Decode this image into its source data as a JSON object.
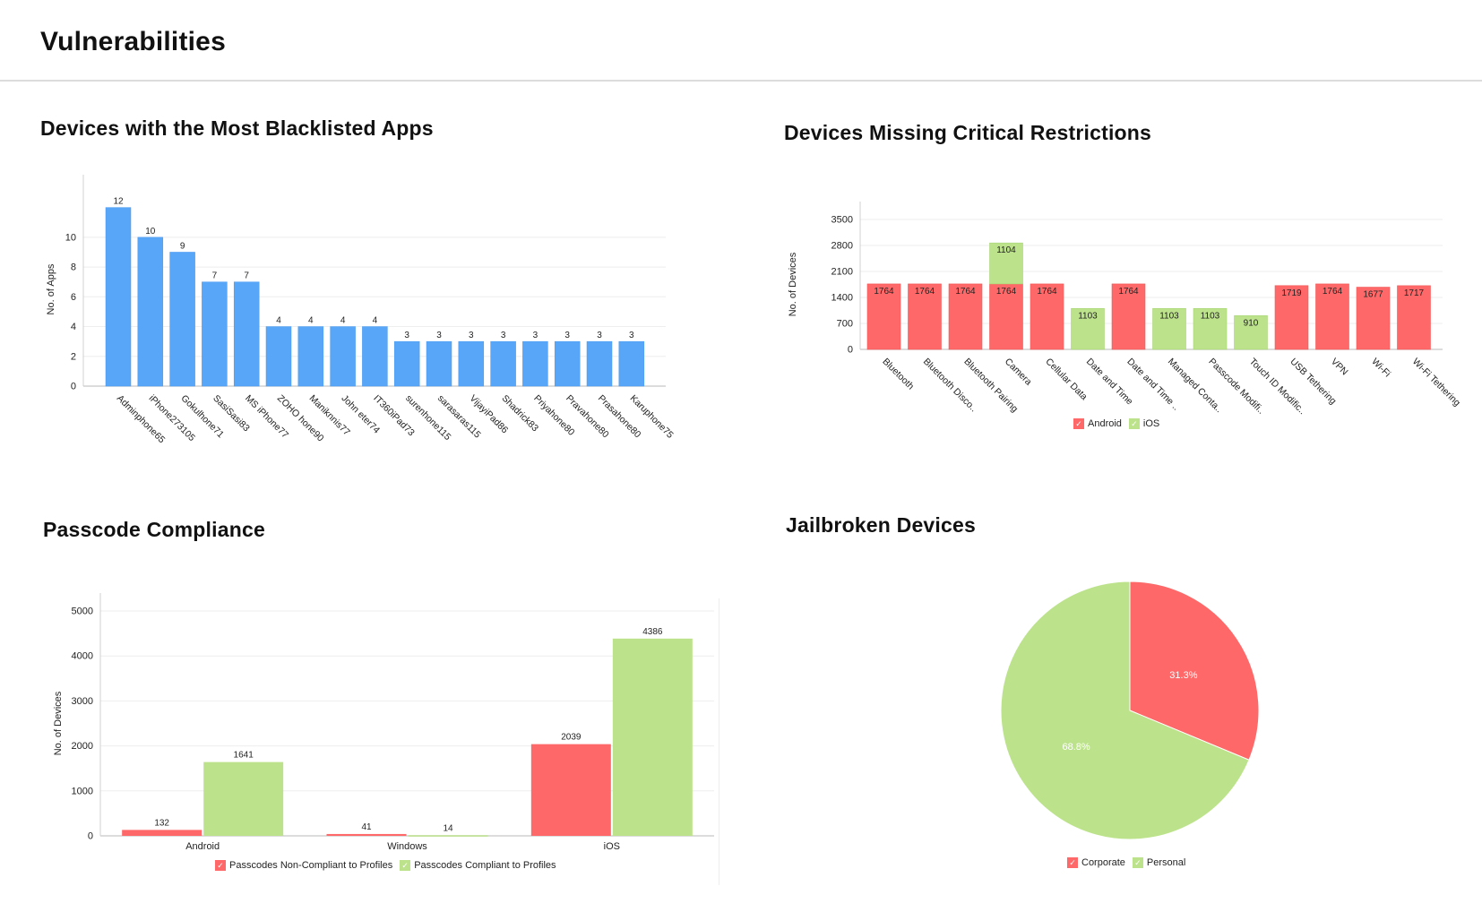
{
  "page": {
    "title": "Vulnerabilities"
  },
  "colors": {
    "blue": "#57a6f8",
    "red": "#ff6868",
    "green": "#bce38b",
    "grid": "#eeeeee",
    "axis": "#d0d0d0"
  },
  "chart_data": [
    {
      "id": "blacklisted",
      "type": "bar",
      "title": "Devices with the Most Blacklisted Apps",
      "xlabel": "",
      "ylabel": "No. of Apps",
      "ylim": [
        0,
        13
      ],
      "yticks": [
        0,
        2,
        4,
        6,
        8,
        10
      ],
      "grid": true,
      "categories": [
        "Adminphone65",
        "iPhone273105",
        "Gokulhone71",
        "SasiSasi83",
        "MS iPhone77",
        "ZOHO hone90",
        "Maniknnis77",
        "John eter74",
        "IT360iPad73",
        "surenhone115",
        "sarasaras115",
        "VijayiPad86",
        "Shadrick83",
        "Priyahone80",
        "Pravahone80",
        "Prasahone80",
        "Karuphone75"
      ],
      "values": [
        12,
        10,
        9,
        7,
        7,
        4,
        4,
        4,
        4,
        3,
        3,
        3,
        3,
        3,
        3,
        3,
        3
      ]
    },
    {
      "id": "restrictions",
      "type": "bar",
      "stacked": true,
      "title": "Devices Missing Critical Restrictions",
      "xlabel": "",
      "ylabel": "No. of Devices",
      "ylim": [
        0,
        3500
      ],
      "yticks": [
        0,
        700,
        1400,
        2100,
        2800,
        3500
      ],
      "grid": true,
      "legend_position": "bottom",
      "categories": [
        "Bluetooth",
        "Bluetooth Disco..",
        "Bluetooth Pairing",
        "Camera",
        "Cellular Data",
        "Date and Time",
        "Date and Time ..",
        "Managed Conta..",
        "Passcode Modifi..",
        "Touch ID Modific..",
        "USB Tethering",
        "VPN",
        "Wi-Fi",
        "Wi-Fi Tethering"
      ],
      "series": [
        {
          "name": "Android",
          "color": "#ff6868",
          "values": [
            1764,
            1764,
            1764,
            1764,
            1764,
            0,
            1764,
            0,
            0,
            0,
            1719,
            1764,
            1677,
            1717
          ]
        },
        {
          "name": "iOS",
          "color": "#bce38b",
          "values": [
            0,
            0,
            0,
            1104,
            0,
            1103,
            0,
            1103,
            1103,
            910,
            0,
            0,
            0,
            0
          ]
        }
      ]
    },
    {
      "id": "passcode",
      "type": "bar",
      "grouped": true,
      "title": "Passcode Compliance",
      "xlabel": "",
      "ylabel": "No. of Devices",
      "ylim": [
        0,
        5000
      ],
      "yticks": [
        0,
        1000,
        2000,
        3000,
        4000,
        5000
      ],
      "grid": true,
      "legend_position": "bottom",
      "categories": [
        "Android",
        "Windows",
        "iOS"
      ],
      "series": [
        {
          "name": "Passcodes Non-Compliant to Profiles",
          "color": "#ff6868",
          "values": [
            132,
            41,
            2039
          ]
        },
        {
          "name": "Passcodes Compliant to Profiles",
          "color": "#bce38b",
          "values": [
            1641,
            14,
            4386
          ]
        }
      ]
    },
    {
      "id": "jailbroken",
      "type": "pie",
      "title": "Jailbroken Devices",
      "legend_position": "bottom",
      "slices": [
        {
          "name": "Corporate",
          "value": 31.3,
          "label": "31.3%",
          "color": "#ff6868"
        },
        {
          "name": "Personal",
          "value": 68.8,
          "label": "68.8%",
          "color": "#bce38b"
        }
      ]
    }
  ]
}
